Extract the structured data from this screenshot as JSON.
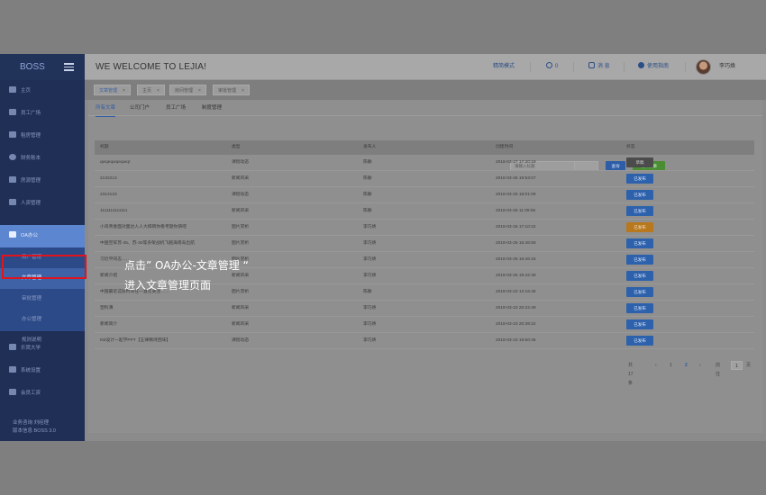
{
  "header": {
    "logo": "BOSS",
    "welcome": "WE WELCOME TO LEJIA!",
    "simple_mode": "精简模式",
    "count": "0",
    "messages": "消 息",
    "help": "使用指南",
    "user": "李巧焕"
  },
  "sidebar": {
    "items": [
      {
        "label": "主页"
      },
      {
        "label": "员工广场"
      },
      {
        "label": "租房管理"
      },
      {
        "label": "财务账本"
      },
      {
        "label": "房源管理"
      },
      {
        "label": "人资管理"
      },
      {
        "label": "OA办公"
      }
    ],
    "oa_sub": [
      {
        "label": "用户管理"
      },
      {
        "label": "文章管理"
      },
      {
        "label": "审批管理"
      },
      {
        "label": "办公管理"
      },
      {
        "label": "规则说明"
      }
    ],
    "bottom_items": [
      {
        "label": "乐窝大学"
      },
      {
        "label": "系统设置"
      },
      {
        "label": "会员工资"
      }
    ],
    "footer_line1": "业务咨询 刘经理",
    "footer_line2": "版本信息 BOSS 3.0"
  },
  "tabs": [
    {
      "label": "文章管理"
    },
    {
      "label": "主页"
    },
    {
      "label": "房间管理"
    },
    {
      "label": "审批管理"
    }
  ],
  "subtabs": [
    {
      "label": "所有文章"
    },
    {
      "label": "公司门户"
    },
    {
      "label": "员工广场"
    },
    {
      "label": "制度管理"
    }
  ],
  "toolbar": {
    "search_placeholder": "请输入标题",
    "query": "查询",
    "publish": "发布文章"
  },
  "table": {
    "columns": [
      "标题",
      "类型",
      "发布人",
      "创建时间",
      "状态"
    ],
    "rows": [
      {
        "title": "qwqeqwqeqwqr",
        "type": "课程动态",
        "author": "陈静",
        "time": "2018-03-27 17:20:19",
        "status": "草稿",
        "status_style": "gray"
      },
      {
        "title": "2132213",
        "type": "新闻风采",
        "author": "陈静",
        "time": "2018-03-26 19:53:07",
        "status": "已发布",
        "status_style": "blue"
      },
      {
        "title": "2313123",
        "type": "课程动态",
        "author": "陈静",
        "time": "2018-03-26 18:01:09",
        "status": "已发布",
        "status_style": "blue"
      },
      {
        "title": "1111111111111",
        "type": "新闻风采",
        "author": "陈静",
        "time": "2018-03-26 11:39:55",
        "status": "已发布",
        "status_style": "blue"
      },
      {
        "title": "小哥青春面对面达人人大揭晓你看考题你猜吧",
        "type": "图片赏析",
        "author": "李巧焕",
        "time": "2018-03-25 17:10:22",
        "status": "已发布",
        "status_style": "orange"
      },
      {
        "title": "中国空军苏-35、苏-30等多架战机飞越海南岛出航",
        "type": "图片赏析",
        "author": "李巧焕",
        "time": "2018-03-25 16:46:59",
        "status": "已发布",
        "status_style": "blue"
      },
      {
        "title": "习近平同志……",
        "type": "图片赏析",
        "author": "李巧焕",
        "time": "2018-03-25 16:46:15",
        "status": "已发布",
        "status_style": "blue"
      },
      {
        "title": "新闻介绍",
        "type": "新闻风采",
        "author": "李巧焕",
        "time": "2018-03-25 19:42:39",
        "status": "已发布",
        "status_style": "blue"
      },
      {
        "title": "中国最近这段时间在一直在关注……",
        "type": "图片赏析",
        "author": "陈静",
        "time": "2018-03-23 13:16:46",
        "status": "已发布",
        "status_style": "blue"
      },
      {
        "title": "塑料薄",
        "type": "新闻风采",
        "author": "李巧焕",
        "time": "2018-03-23 20:22:49",
        "status": "已发布",
        "status_style": "blue"
      },
      {
        "title": "新闻简介",
        "type": "新闻风采",
        "author": "李巧焕",
        "time": "2018-03-23 20:39:22",
        "status": "已发布",
        "status_style": "blue"
      },
      {
        "title": "KB设计一起学PPT【五律精诗回味】",
        "type": "课程动态",
        "author": "李巧焕",
        "time": "2018-03-23 19:50:46",
        "status": "已发布",
        "status_style": "blue"
      }
    ]
  },
  "pagination": {
    "total": "共 17 条",
    "prev": "‹",
    "page1": "1",
    "page2": "2",
    "next": "›",
    "goto_label": "前往",
    "goto_value": "1",
    "page_unit": "页"
  },
  "annotation": {
    "line1": "点击” OA办公-文章管理 “",
    "line2": "进入文章管理页面"
  },
  "colors": {
    "sidebar": "#1f2f55",
    "highlight": "#e1141c",
    "primary": "#2c5da6",
    "success": "#4a8d33",
    "draft": "#4b4b4b",
    "warning": "#b8781d"
  }
}
